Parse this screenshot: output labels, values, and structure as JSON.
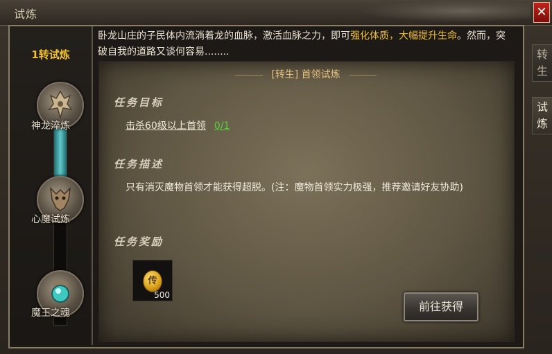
{
  "window": {
    "title": "试炼",
    "close_label": "✕"
  },
  "side_tabs": [
    {
      "label": "转生",
      "active": false
    },
    {
      "label": "试炼",
      "active": true
    }
  ],
  "sidebar": {
    "title": "1转试炼",
    "progress_fill": 0.46,
    "nodes": [
      {
        "label": "神龙淬炼",
        "icon": "dragon-helmet-icon"
      },
      {
        "label": "心魔试炼",
        "icon": "demon-beast-icon"
      },
      {
        "label": "魔王之魂",
        "icon": "soul-orb-icon"
      }
    ]
  },
  "intro": {
    "text_a": "卧龙山庄的子民体内流淌着龙的血脉，激活血脉之力，即可",
    "highlight": "强化体质，大幅提升生命",
    "text_b": "。然而，突破自我的道路又谈何容易........"
  },
  "quest": {
    "title": "[转生] 首领试炼",
    "objective_heading": "任务目标",
    "objective_text": "击杀60级以上首领",
    "objective_progress": "0/1",
    "desc_heading": "任务描述",
    "desc_text": "只有消灭魔物首领才能获得超脱。(注：魔物首领实力极强，推荐邀请好友协助)",
    "reward_heading": "任务奖励",
    "reward_glyph": "传",
    "reward_qty": "500",
    "go_button": "前往获得"
  },
  "colors": {
    "highlight": "#f2c12e",
    "progress": "#56d33a",
    "close": "#c22218"
  }
}
